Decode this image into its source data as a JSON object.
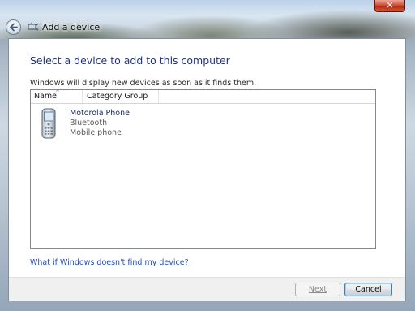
{
  "window": {
    "title": "Add a device",
    "close_glyph": "✕"
  },
  "content": {
    "heading": "Select a device to add to this computer",
    "description": "Windows will display new devices as soon as it finds them."
  },
  "listview": {
    "columns": [
      "Name",
      "Category Group"
    ],
    "sort_indicator": "^",
    "items": [
      {
        "name": "Motorola Phone",
        "type": "Bluetooth",
        "category": "Mobile phone",
        "icon": "mobile-phone-icon"
      }
    ]
  },
  "help_link": "What if Windows doesn't find my device?",
  "buttons": {
    "next": "Next",
    "cancel": "Cancel",
    "next_enabled": false
  },
  "colors": {
    "heading": "#1e3287",
    "link": "#2548b8"
  }
}
